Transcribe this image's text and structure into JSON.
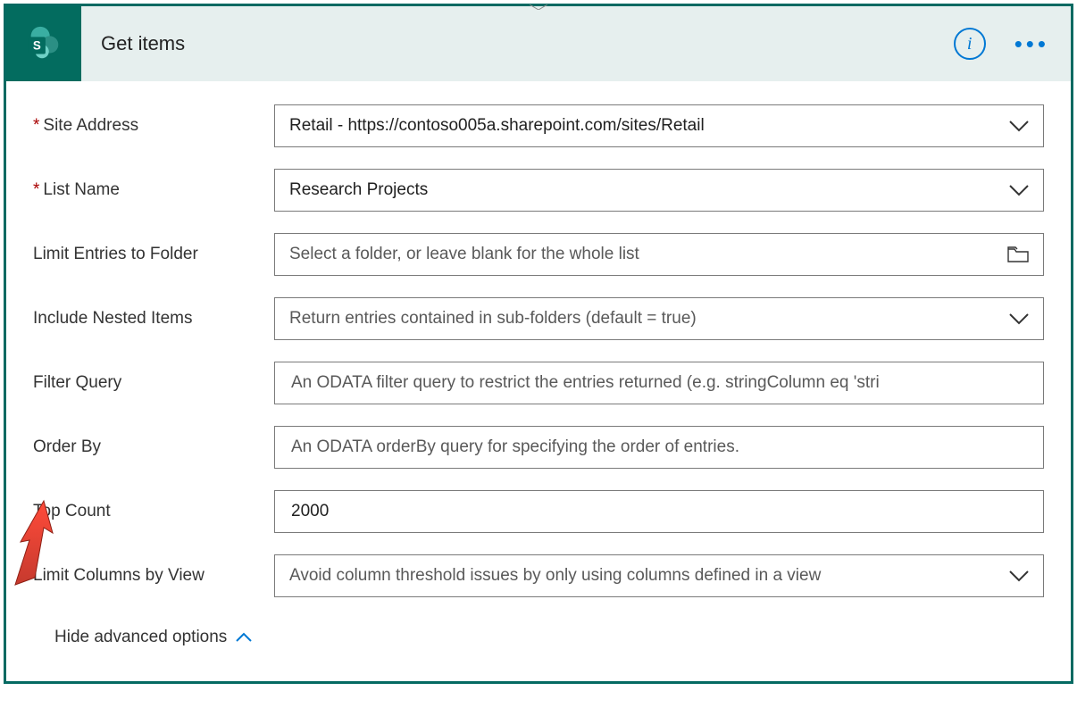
{
  "header": {
    "title": "Get items",
    "info_tooltip": "i",
    "more": "···"
  },
  "fields": {
    "site_address": {
      "label": "Site Address",
      "required": true,
      "value": "Retail - https://contoso005a.sharepoint.com/sites/Retail"
    },
    "list_name": {
      "label": "List Name",
      "required": true,
      "value": "Research Projects"
    },
    "limit_folder": {
      "label": "Limit Entries to Folder",
      "placeholder": "Select a folder, or leave blank for the whole list"
    },
    "include_nested": {
      "label": "Include Nested Items",
      "placeholder": "Return entries contained in sub-folders (default = true)"
    },
    "filter_query": {
      "label": "Filter Query",
      "placeholder": "An ODATA filter query to restrict the entries returned (e.g. stringColumn eq 'stri"
    },
    "order_by": {
      "label": "Order By",
      "placeholder": "An ODATA orderBy query for specifying the order of entries."
    },
    "top_count": {
      "label": "Top Count",
      "value": "2000"
    },
    "limit_columns": {
      "label": "Limit Columns by View",
      "placeholder": "Avoid column threshold issues by only using columns defined in a view"
    }
  },
  "footer": {
    "hide_advanced": "Hide advanced options"
  },
  "colors": {
    "teal": "#036c5f",
    "blue": "#0078d4",
    "header_bg": "#e6efee"
  }
}
